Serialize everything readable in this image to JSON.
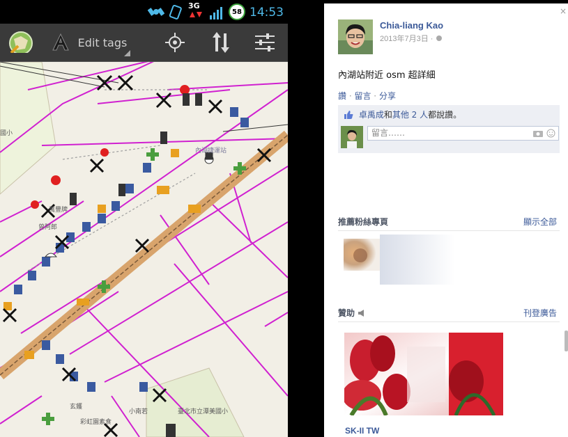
{
  "phone": {
    "status_bar": {
      "network": "3G",
      "battery": "58",
      "time": "14:53",
      "icons": [
        "satellite-icon",
        "rotation-icon",
        "network-3g-icon",
        "signal-icon",
        "battery-icon"
      ]
    },
    "toolbar": {
      "edit_tags_label": "Edit tags",
      "icons": [
        "map-mode-icon",
        "text-mode-icon",
        "gps-locate-icon",
        "transfer-icon",
        "settings-sliders-icon"
      ]
    },
    "map": {
      "labels": [
        "國小",
        "內湖捷運站",
        "曾阿郎",
        "萬豐牌",
        "臺北市立潭美國小",
        "小南若",
        "玄鑊",
        "彩虹園素食"
      ]
    }
  },
  "facebook": {
    "close": "×",
    "post": {
      "author": "Chia-liang Kao",
      "date": "2013年7月3日 ·",
      "text": "內湖站附近 osm 超詳細",
      "actions": [
        "讚",
        "留言",
        "分享"
      ],
      "likes": {
        "name": "卓禹成",
        "conj": "和",
        "others": "其他 2 人",
        "suffix": "都說讚。"
      },
      "comment_placeholder": "留言……"
    },
    "recommended": {
      "title": "推薦粉絲專頁",
      "link": "顯示全部"
    },
    "sponsored": {
      "title": "贊助",
      "link": "刊登廣告",
      "brand": "SK-II TW"
    }
  }
}
